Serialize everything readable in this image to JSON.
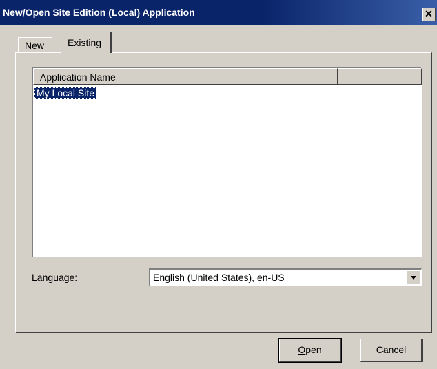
{
  "window": {
    "title": "New/Open Site Edition (Local) Application",
    "close_glyph": "✕"
  },
  "tabs": [
    {
      "label": "New",
      "selected": false
    },
    {
      "label": "Existing",
      "selected": true
    }
  ],
  "list": {
    "columns": [
      "Application Name",
      ""
    ],
    "rows": [
      {
        "name": "My Local Site",
        "selected": true
      }
    ]
  },
  "language": {
    "label_accel": "L",
    "label_rest": "anguage:",
    "selected": "English (United States), en-US"
  },
  "buttons": {
    "open_accel": "O",
    "open_rest": "pen",
    "cancel": "Cancel"
  },
  "colors": {
    "titlebar": "#0a246a",
    "face": "#d4d0c8",
    "selection": "#0a246a"
  },
  "icons": {
    "close": "close-icon",
    "dropdown": "chevron-down-icon"
  }
}
